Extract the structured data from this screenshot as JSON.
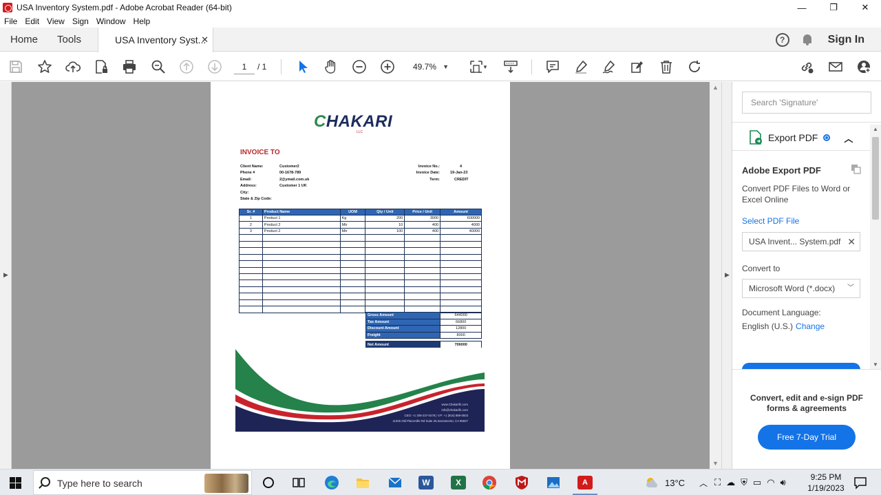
{
  "window": {
    "title": "USA Inventory System.pdf - Adobe Acrobat Reader (64-bit)",
    "minimize": "—",
    "maximize": "❐",
    "close": "✕"
  },
  "menu": [
    "File",
    "Edit",
    "View",
    "Sign",
    "Window",
    "Help"
  ],
  "tabs": {
    "home": "Home",
    "tools": "Tools",
    "document": "USA Inventory Syst...",
    "close": "✕",
    "sign_in": "Sign In",
    "help": "?"
  },
  "toolbar": {
    "page_current": "1",
    "page_total": "/ 1",
    "zoom": "49.7%"
  },
  "invoice": {
    "logo_text": "HAKARI",
    "logo_c": "C",
    "logo_sub": "LLC",
    "heading": "INVOICE TO",
    "client_labels": [
      "Client Name:",
      "Phone #",
      "Email:",
      "Address:",
      "City:",
      "State & Zip Code:"
    ],
    "client_values": [
      "Customer2",
      "00-1678-789",
      "2@ymail.com.uk",
      "Customer 1  UK",
      "",
      ""
    ],
    "invoice_labels": [
      "Invoice No.:",
      "Invoice Date:",
      "Term:"
    ],
    "invoice_values": [
      "4",
      "19-Jan-23",
      "CREDIT"
    ],
    "table_headers": [
      "Sr. #",
      "Product Name",
      "UOM",
      "Qty / Unit",
      "Price / Unit",
      "Amount"
    ],
    "rows": [
      [
        "1",
        "Product 1",
        "Kg",
        "200",
        "3000",
        "600000"
      ],
      [
        "2",
        "Product 2",
        "Mtr",
        "10",
        "400",
        "4000"
      ],
      [
        "3",
        "Product 2",
        "Mtr",
        "100",
        "400",
        "40000"
      ]
    ],
    "totals": [
      {
        "label": "Gross Amount",
        "value": "644000"
      },
      {
        "label": "Tax Amount",
        "value": "66800"
      },
      {
        "label": "Discount Amount",
        "value": "12800"
      },
      {
        "label": "Freight",
        "value": "8000"
      }
    ],
    "net_label": "Net Amount",
    "net_value": "706000",
    "contact": [
      "www.Chakarillc.com",
      "info@chakarillc.com",
      "CEO: +1 209-237-0478 | V.P: +1 (916) 889-0503",
      "11025 Old Placerville Rd Suite 25,Sacramento, CA 95827"
    ]
  },
  "right_panel": {
    "search_placeholder": "Search 'Signature'",
    "export_title": "Export PDF",
    "aep_title": "Adobe Export PDF",
    "aep_desc": "Convert PDF Files to Word or Excel Online",
    "select_file": "Select PDF File",
    "file_name": "USA Invent... System.pdf",
    "convert_to": "Convert to",
    "convert_format": "Microsoft Word (*.docx)",
    "doc_lang_label": "Document Language:",
    "doc_lang_value": "English (U.S.)",
    "change": "Change",
    "promo": "Convert, edit and e-sign PDF forms & agreements",
    "trial": "Free 7-Day Trial"
  },
  "taskbar": {
    "search_text": "Type here to search",
    "temperature": "13°C",
    "time": "9:25 PM",
    "date": "1/19/2023"
  },
  "colors": {
    "accent": "#1473e6",
    "table_header": "#2f66b3",
    "brand_red": "#b52a2a",
    "brand_green": "#2a8a4a",
    "brand_navy": "#1f2457"
  }
}
